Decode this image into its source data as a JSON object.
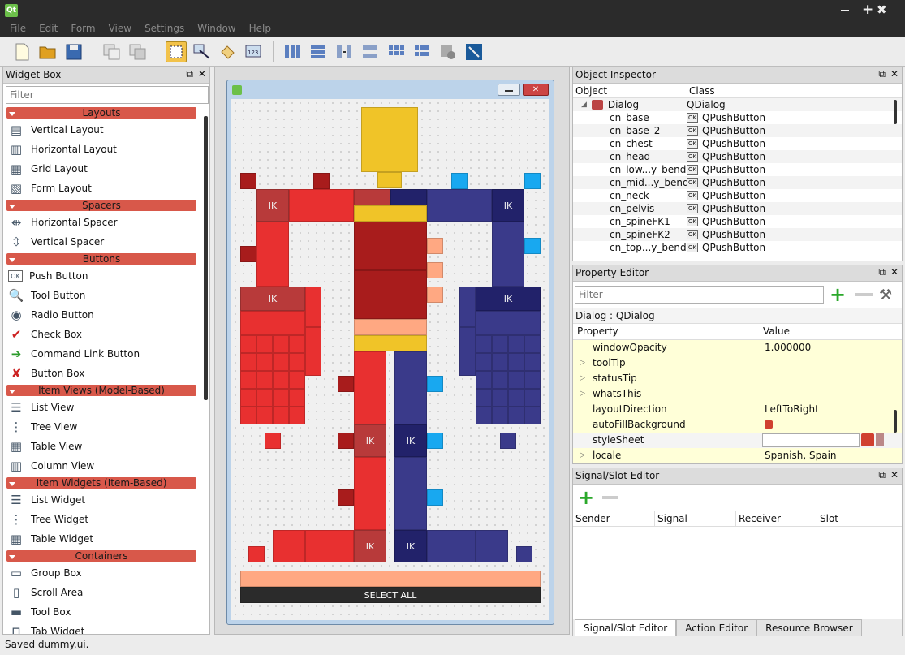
{
  "menu": [
    "File",
    "Edit",
    "Form",
    "View",
    "Settings",
    "Window",
    "Help"
  ],
  "window_controls": {
    "plus": "+",
    "close": "✖"
  },
  "widget_box": {
    "title": "Widget Box",
    "filter_placeholder": "Filter",
    "categories": [
      {
        "name": "Layouts",
        "items": [
          {
            "label": "Vertical Layout",
            "icon": "vertical-layout-icon"
          },
          {
            "label": "Horizontal Layout",
            "icon": "horizontal-layout-icon"
          },
          {
            "label": "Grid Layout",
            "icon": "grid-layout-icon"
          },
          {
            "label": "Form Layout",
            "icon": "form-layout-icon"
          }
        ]
      },
      {
        "name": "Spacers",
        "items": [
          {
            "label": "Horizontal Spacer",
            "icon": "horizontal-spacer-icon"
          },
          {
            "label": "Vertical Spacer",
            "icon": "vertical-spacer-icon"
          }
        ]
      },
      {
        "name": "Buttons",
        "items": [
          {
            "label": "Push Button",
            "icon": "push-button-icon"
          },
          {
            "label": "Tool Button",
            "icon": "tool-button-icon"
          },
          {
            "label": "Radio Button",
            "icon": "radio-button-icon"
          },
          {
            "label": "Check Box",
            "icon": "check-box-icon"
          },
          {
            "label": "Command Link Button",
            "icon": "command-link-icon"
          },
          {
            "label": "Button Box",
            "icon": "button-box-icon"
          }
        ]
      },
      {
        "name": "Item Views (Model-Based)",
        "items": [
          {
            "label": "List View",
            "icon": "list-view-icon"
          },
          {
            "label": "Tree View",
            "icon": "tree-view-icon"
          },
          {
            "label": "Table View",
            "icon": "table-view-icon"
          },
          {
            "label": "Column View",
            "icon": "column-view-icon"
          }
        ]
      },
      {
        "name": "Item Widgets (Item-Based)",
        "items": [
          {
            "label": "List Widget",
            "icon": "list-widget-icon"
          },
          {
            "label": "Tree Widget",
            "icon": "tree-widget-icon"
          },
          {
            "label": "Table Widget",
            "icon": "table-widget-icon"
          }
        ]
      },
      {
        "name": "Containers",
        "items": [
          {
            "label": "Group Box",
            "icon": "group-box-icon"
          },
          {
            "label": "Scroll Area",
            "icon": "scroll-area-icon"
          },
          {
            "label": "Tool Box",
            "icon": "tool-box-icon"
          },
          {
            "label": "Tab Widget",
            "icon": "tab-widget-icon"
          }
        ]
      }
    ]
  },
  "form": {
    "ik_label": "IK",
    "select_all": "SELECT ALL",
    "colors": {
      "red": "#e83030",
      "darkred": "#a81c1c",
      "midred": "#b83a3a",
      "navy": "#3a3a8a",
      "darknavy": "#22226a",
      "yellow": "#f0c428",
      "peach": "#ffa882",
      "cyan": "#18a8f0",
      "black": "#2b2b2b"
    }
  },
  "object_inspector": {
    "title": "Object Inspector",
    "col_object": "Object",
    "col_class": "Class",
    "root": {
      "name": "Dialog",
      "class": "QDialog"
    },
    "rows": [
      {
        "name": "cn_base",
        "class": "QPushButton"
      },
      {
        "name": "cn_base_2",
        "class": "QPushButton"
      },
      {
        "name": "cn_chest",
        "class": "QPushButton"
      },
      {
        "name": "cn_head",
        "class": "QPushButton"
      },
      {
        "name": "cn_low...y_bend",
        "class": "QPushButton"
      },
      {
        "name": "cn_mid...y_bend",
        "class": "QPushButton"
      },
      {
        "name": "cn_neck",
        "class": "QPushButton"
      },
      {
        "name": "cn_pelvis",
        "class": "QPushButton"
      },
      {
        "name": "cn_spineFK1",
        "class": "QPushButton"
      },
      {
        "name": "cn_spineFK2",
        "class": "QPushButton"
      },
      {
        "name": "cn_top...y_bend",
        "class": "QPushButton"
      }
    ]
  },
  "property_editor": {
    "title": "Property Editor",
    "filter_placeholder": "Filter",
    "context": "Dialog : QDialog",
    "col_property": "Property",
    "col_value": "Value",
    "rows": [
      {
        "name": "windowOpacity",
        "value": "1.000000",
        "expand": false
      },
      {
        "name": "toolTip",
        "value": "",
        "expand": true
      },
      {
        "name": "statusTip",
        "value": "",
        "expand": true
      },
      {
        "name": "whatsThis",
        "value": "",
        "expand": true
      },
      {
        "name": "layoutDirection",
        "value": "LeftToRight",
        "expand": false
      },
      {
        "name": "autoFillBackground",
        "value": "",
        "expand": false
      },
      {
        "name": "styleSheet",
        "value": "",
        "expand": false
      },
      {
        "name": "locale",
        "value": "Spanish, Spain",
        "expand": true
      }
    ]
  },
  "signal_slot": {
    "title": "Signal/Slot Editor",
    "cols": [
      "Sender",
      "Signal",
      "Receiver",
      "Slot"
    ],
    "tabs": [
      "Signal/Slot Editor",
      "Action Editor",
      "Resource Browser"
    ]
  },
  "status": "Saved dummy.ui."
}
